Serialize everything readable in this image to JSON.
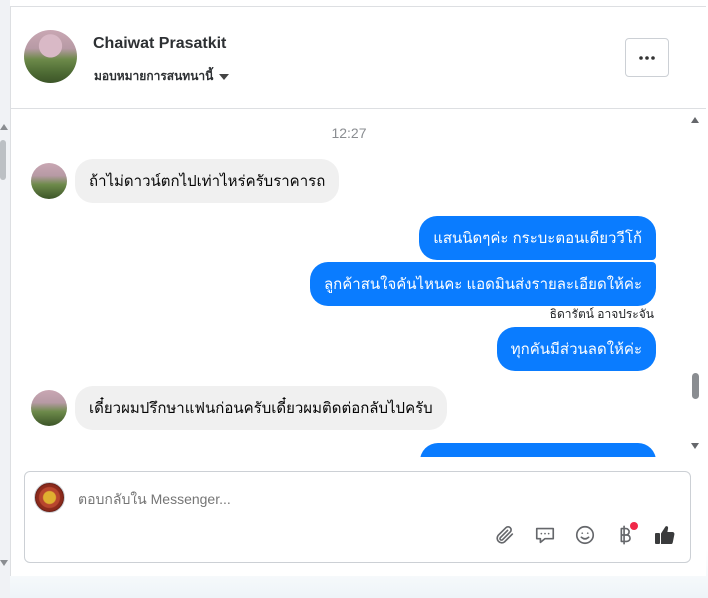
{
  "header": {
    "name": "Chaiwat Prasatkit",
    "assign_label": "มอบหมายการสนทนานี้",
    "more_label": "···"
  },
  "thread": {
    "timestamp": "12:27",
    "messages": [
      {
        "direction": "incoming",
        "text": "ถ้าไม่ดาวน์ตกไปเท่าไหร่ครับราคารถ"
      },
      {
        "direction": "outgoing",
        "text": "แสนนิดๆค่ะ กระบะตอนเดียววีโก้"
      },
      {
        "direction": "outgoing",
        "text": "ลูกค้าสนใจคันไหนคะ แอดมินส่งรายละเอียดให้ค่ะ"
      },
      {
        "direction": "outgoing",
        "text": "ทุกคันมีส่วนลดให้ค่ะ",
        "sender": "ธิดารัตน์ อาจประจัน"
      },
      {
        "direction": "incoming",
        "text": "เดี๋ยวผมปรึกษาแฟนก่อนครับเดี๋ยวผมติดต่อกลับไปครับ"
      }
    ]
  },
  "composer": {
    "placeholder": "ตอบกลับใน Messenger...",
    "tools": [
      "attachment-icon",
      "saved-reply-icon",
      "emoji-icon",
      "payment-icon",
      "like-icon"
    ]
  },
  "colors": {
    "outgoing_bubble": "#0a7cff",
    "incoming_bubble": "#f0f0f0",
    "notification_dot": "#f02849"
  }
}
